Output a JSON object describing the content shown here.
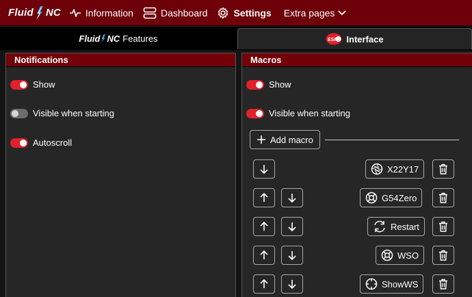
{
  "brand": {
    "left": "Fluid",
    "right": "NC"
  },
  "nav": {
    "information": "Information",
    "dashboard": "Dashboard",
    "settings": "Settings",
    "extra_pages": "Extra pages"
  },
  "tabs": {
    "features_suffix": "Features",
    "interface": "Interface"
  },
  "notifications": {
    "title": "Notifications",
    "show": {
      "label": "Show",
      "on": true
    },
    "visible_when_starting": {
      "label": "Visible when starting",
      "on": false
    },
    "autoscroll": {
      "label": "Autoscroll",
      "on": true
    }
  },
  "macros": {
    "title": "Macros",
    "show": {
      "label": "Show",
      "on": true
    },
    "visible_when_starting": {
      "label": "Visible when starting",
      "on": true
    },
    "add_label": "Add macro",
    "items": [
      {
        "name": "X22Y17",
        "icon": "aperture-icon"
      },
      {
        "name": "G54Zero",
        "icon": "life-buoy-icon"
      },
      {
        "name": "Restart",
        "icon": "refresh-icon"
      },
      {
        "name": "WSO",
        "icon": "life-buoy-icon"
      },
      {
        "name": "ShowWS",
        "icon": "crosshair-icon"
      }
    ]
  },
  "colors": {
    "accent": "#6d0008",
    "toggle_on": "#e0212b"
  }
}
